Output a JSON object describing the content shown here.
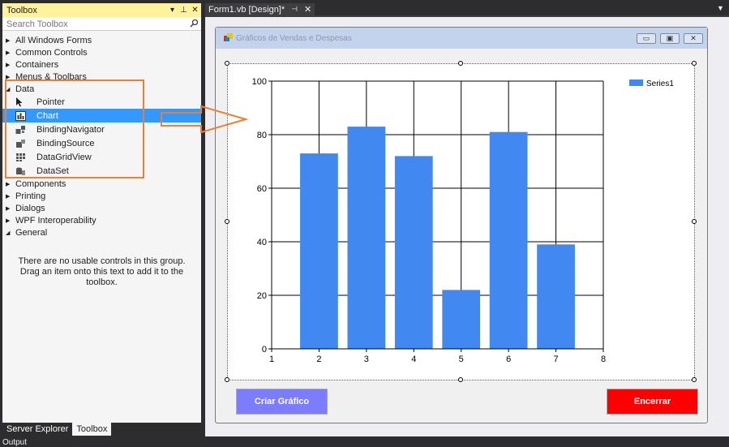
{
  "toolbox": {
    "title": "Toolbox",
    "search_placeholder": "Search Toolbox",
    "groups_before": [
      "All Windows Forms",
      "Common Controls",
      "Containers",
      "Menus & Toolbars"
    ],
    "data_group": "Data",
    "data_items": [
      "Pointer",
      "Chart",
      "BindingNavigator",
      "BindingSource",
      "DataGridView",
      "DataSet"
    ],
    "groups_after": [
      "Components",
      "Printing",
      "Dialogs",
      "WPF Interoperability"
    ],
    "general_group": "General",
    "general_empty": "There are no usable controls in this group. Drag an item onto this text to add it to the toolbox."
  },
  "bottom_tabs": [
    "Server Explorer",
    "Toolbox"
  ],
  "bottom_extra": "Output",
  "document_tab": "Form1.vb [Design]*",
  "form": {
    "title": "Gráficos de Vendas e Despesas",
    "criar_label": "Criar Gráfico",
    "encerrar_label": "Encerrar"
  },
  "chart_data": {
    "type": "bar",
    "x": [
      2,
      3,
      4,
      5,
      6,
      7
    ],
    "values": [
      73,
      83,
      72,
      22,
      81,
      39
    ],
    "series": [
      {
        "name": "Series1",
        "values": [
          73,
          83,
          72,
          22,
          81,
          39
        ]
      }
    ],
    "xlim": [
      1,
      8
    ],
    "ylim": [
      0,
      100
    ],
    "x_ticks": [
      1,
      2,
      3,
      4,
      5,
      6,
      7,
      8
    ],
    "y_ticks": [
      0,
      20,
      40,
      60,
      80,
      100
    ],
    "grid": true,
    "legend": "top-right",
    "bar_color": "#4189f0"
  },
  "colors": {
    "selection": "#3399ff",
    "annotation": "#ed7d31",
    "criar": "#7c7cff",
    "encerrar": "#ff0000"
  }
}
